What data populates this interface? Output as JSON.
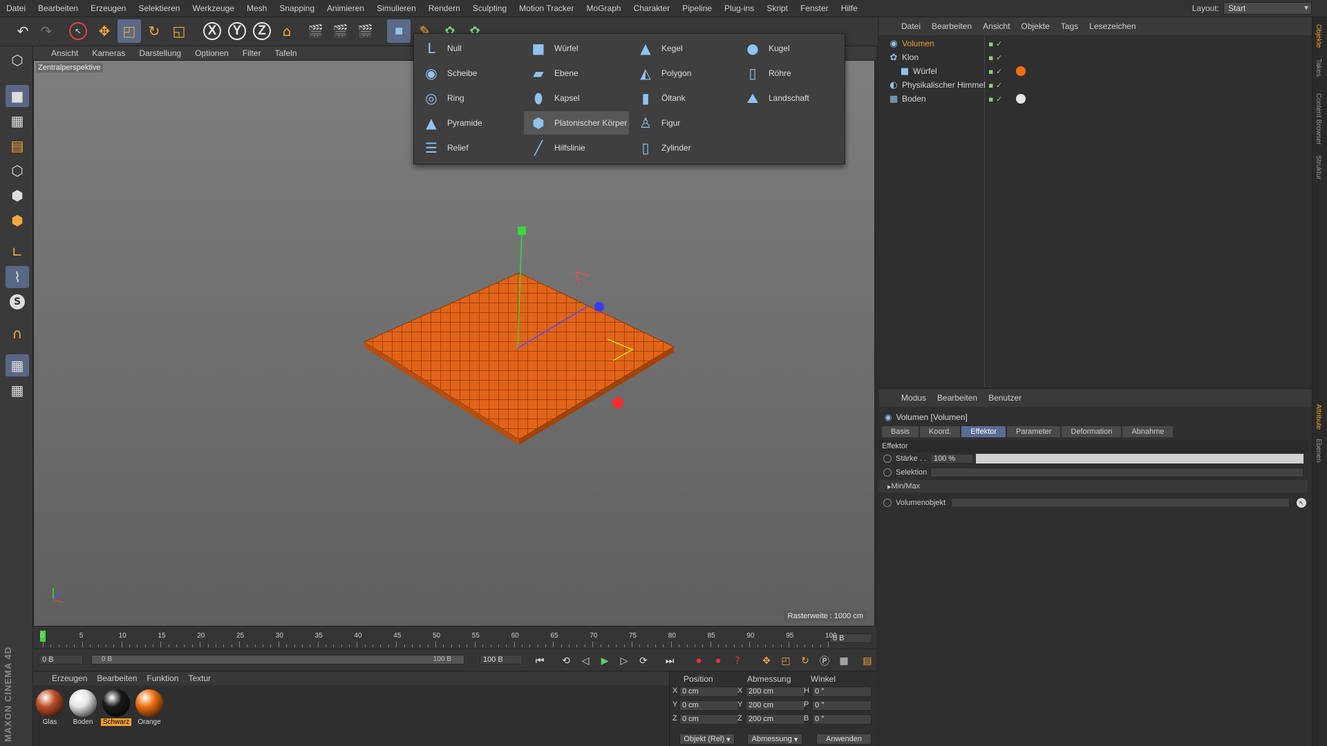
{
  "menu": [
    "Datei",
    "Bearbeiten",
    "Erzeugen",
    "Selektieren",
    "Werkzeuge",
    "Mesh",
    "Snapping",
    "Animieren",
    "Simulieren",
    "Rendern",
    "Sculpting",
    "Motion Tracker",
    "MoGraph",
    "Charakter",
    "Pipeline",
    "Plug-ins",
    "Skript",
    "Fenster",
    "Hilfe"
  ],
  "layout": {
    "label": "Layout:",
    "value": "Start"
  },
  "viewport_menu": [
    "Ansicht",
    "Kameras",
    "Darstellung",
    "Optionen",
    "Filter",
    "Tafeln"
  ],
  "viewport": {
    "label": "Zentralperspektive",
    "raster": "Rasterweite : 1000 cm"
  },
  "dropdown": {
    "items": [
      {
        "label": "Null",
        "icon": "null-icon",
        "glyph": "L"
      },
      {
        "label": "Scheibe",
        "icon": "disc-icon",
        "glyph": "◉"
      },
      {
        "label": "Ring",
        "icon": "ring-icon",
        "glyph": "◎"
      },
      {
        "label": "Pyramide",
        "icon": "pyramid-icon",
        "glyph": "▲"
      },
      {
        "label": "Relief",
        "icon": "relief-icon",
        "glyph": "☰"
      },
      {
        "label": "Würfel",
        "icon": "cube-icon",
        "glyph": "■"
      },
      {
        "label": "Ebene",
        "icon": "plane-icon",
        "glyph": "▰"
      },
      {
        "label": "Kapsel",
        "icon": "capsule-icon",
        "glyph": "⬮"
      },
      {
        "label": "Platonischer Körper",
        "icon": "platonic-icon",
        "glyph": "⬢"
      },
      {
        "label": "Hilfslinie",
        "icon": "guide-line-icon",
        "glyph": "╱"
      },
      {
        "label": "Kegel",
        "icon": "cone-icon",
        "glyph": "▲"
      },
      {
        "label": "Polygon",
        "icon": "polygon-icon",
        "glyph": "◭"
      },
      {
        "label": "Öltank",
        "icon": "oiltank-icon",
        "glyph": "▮"
      },
      {
        "label": "Figur",
        "icon": "figure-icon",
        "glyph": "♙"
      },
      {
        "label": "Zylinder",
        "icon": "cylinder-icon",
        "glyph": "▯"
      },
      {
        "label": "Kugel",
        "icon": "sphere-icon",
        "glyph": "●"
      },
      {
        "label": "Röhre",
        "icon": "tube-icon",
        "glyph": "▯"
      },
      {
        "label": "Landschaft",
        "icon": "landscape-icon",
        "glyph": "⛰"
      }
    ]
  },
  "objects_menu": [
    "Datei",
    "Bearbeiten",
    "Ansicht",
    "Objekte",
    "Tags",
    "Lesezeichen"
  ],
  "objects": [
    {
      "name": "Volumen",
      "icon": "volume-icon",
      "color": "#f0a030"
    },
    {
      "name": "Klon",
      "icon": "cloner-icon",
      "color": "#d6d6d6"
    },
    {
      "name": "Würfel",
      "icon": "cube-icon",
      "color": "#d6d6d6"
    },
    {
      "name": "Physikalischer Himmel",
      "icon": "sky-icon",
      "color": "#d6d6d6"
    },
    {
      "name": "Boden",
      "icon": "floor-icon",
      "color": "#d6d6d6"
    }
  ],
  "side_tabs": [
    "Objekte",
    "Takes",
    "Content Browser",
    "Struktur",
    "Attribute",
    "Ebenen"
  ],
  "attributes": {
    "menu": [
      "Modus",
      "Bearbeiten",
      "Benutzer"
    ],
    "title": "Volumen [Volumen]",
    "tabs": [
      "Basis",
      "Koord.",
      "Effektor",
      "Parameter",
      "Deformation",
      "Abnahme"
    ],
    "active_tab": "Effektor",
    "section": "Effektor",
    "strength_label": "Stärke . .",
    "strength_value": "100 %",
    "strength_fraction": 1.0,
    "selection_label": "Selektion",
    "minmax_label": "Min/Max",
    "volume_object_label": "Volumenobjekt"
  },
  "timeline": {
    "ticks": [
      "0",
      "5",
      "10",
      "15",
      "20",
      "25",
      "30",
      "35",
      "40",
      "45",
      "50",
      "55",
      "60",
      "65",
      "70",
      "75",
      "80",
      "85",
      "90",
      "95",
      "100"
    ],
    "current_frame": "0 B",
    "start": "0 B",
    "range_start": "0 B",
    "range_end": "100 B",
    "end": "100 B"
  },
  "materials_menu": [
    "Erzeugen",
    "Bearbeiten",
    "Funktion",
    "Textur"
  ],
  "materials": [
    {
      "name": "Glas",
      "color": "#c0502a"
    },
    {
      "name": "Boden",
      "color": "#e6e6e6"
    },
    {
      "name": "Schwarz",
      "color": "#1a1a1a"
    },
    {
      "name": "Orange",
      "color": "#f07010"
    }
  ],
  "coords": {
    "headers": [
      "Position",
      "Abmessung",
      "Winkel"
    ],
    "rows": [
      {
        "axis": "X",
        "pos": "0 cm",
        "dim_axis": "X",
        "dim": "200 cm",
        "rot_axis": "H",
        "rot": "0 °"
      },
      {
        "axis": "Y",
        "pos": "0 cm",
        "dim_axis": "Y",
        "dim": "200 cm",
        "rot_axis": "P",
        "rot": "0 °"
      },
      {
        "axis": "Z",
        "pos": "0 cm",
        "dim_axis": "Z",
        "dim": "200 cm",
        "rot_axis": "B",
        "rot": "0 °"
      }
    ],
    "mode": "Objekt (Rel)",
    "dim_mode": "Abmessung",
    "apply": "Anwenden"
  },
  "brand": "MAXON CINEMA 4D"
}
